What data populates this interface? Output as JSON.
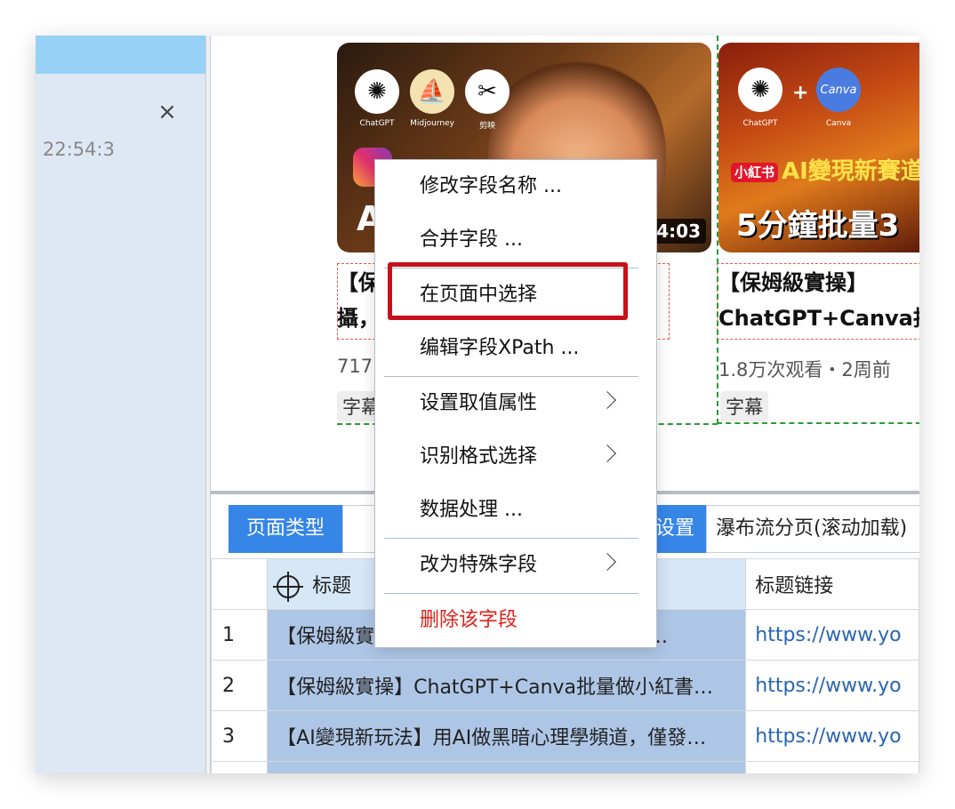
{
  "left_panel": {
    "close_icon": "close-icon",
    "time": "22:54:3"
  },
  "cards": [
    {
      "logos": [
        {
          "name": "chatgpt-logo",
          "caption": "ChatGPT",
          "glyph": "✺"
        },
        {
          "name": "midjourney-logo",
          "caption": "Midjourney",
          "glyph": "⛵"
        },
        {
          "name": "capcut-logo",
          "caption": "剪映",
          "glyph": "✂"
        }
      ],
      "thumbnail_text": "A",
      "duration": "4:03",
      "title_line1": "【保",
      "title_line2": "攝，",
      "views": "717",
      "tag": "字幕"
    },
    {
      "logos": [
        {
          "name": "chatgpt-logo",
          "caption": "ChatGPT",
          "glyph": "✺"
        },
        {
          "name": "canva-logo",
          "caption": "Canva",
          "glyph": "Canva"
        }
      ],
      "plus": "+",
      "thumbnail_badge": "小紅书",
      "thumbnail_line1": "AI變現新賽道",
      "thumbnail_line2": "5分鐘批量3",
      "title_line1": "【保姆級實操】",
      "title_line2": "ChatGPT+Canva批",
      "views": "1.8万次观看・2周前",
      "tag": "字幕"
    }
  ],
  "config": {
    "page_type_label": "页面类型",
    "setting_label": "设置",
    "setting_value": "瀑布流分页(滚动加载)"
  },
  "table": {
    "headers": {
      "title": "标题",
      "link": "标题链接"
    },
    "rows": [
      {
        "idx": "1",
        "title": "【保姆級實操】中國最新商機，一鍵生產治…",
        "link": "https://www.yo"
      },
      {
        "idx": "2",
        "title": "【保姆級實操】ChatGPT+Canva批量做小紅書…",
        "link": "https://www.yo"
      },
      {
        "idx": "3",
        "title": "【AI變現新玩法】用AI做黑暗心理學頻道，僅發…",
        "link": "https://www.yo"
      }
    ]
  },
  "context_menu": {
    "items": [
      {
        "label": "修改字段名称 ..."
      },
      {
        "label": "合并字段 ..."
      },
      {
        "label": "在页面中选择"
      },
      {
        "label": "编辑字段XPath ..."
      },
      {
        "label": "设置取值属性",
        "submenu": true
      },
      {
        "label": "识别格式选择",
        "submenu": true
      },
      {
        "label": "数据处理 ..."
      },
      {
        "label": "改为特殊字段",
        "submenu": true
      },
      {
        "label": "删除该字段",
        "danger": true
      }
    ]
  },
  "colors": {
    "accent_blue": "#3686e8",
    "highlight_red": "#c8101a",
    "danger_red": "#e1201a",
    "left_header": "#97d2f6"
  }
}
